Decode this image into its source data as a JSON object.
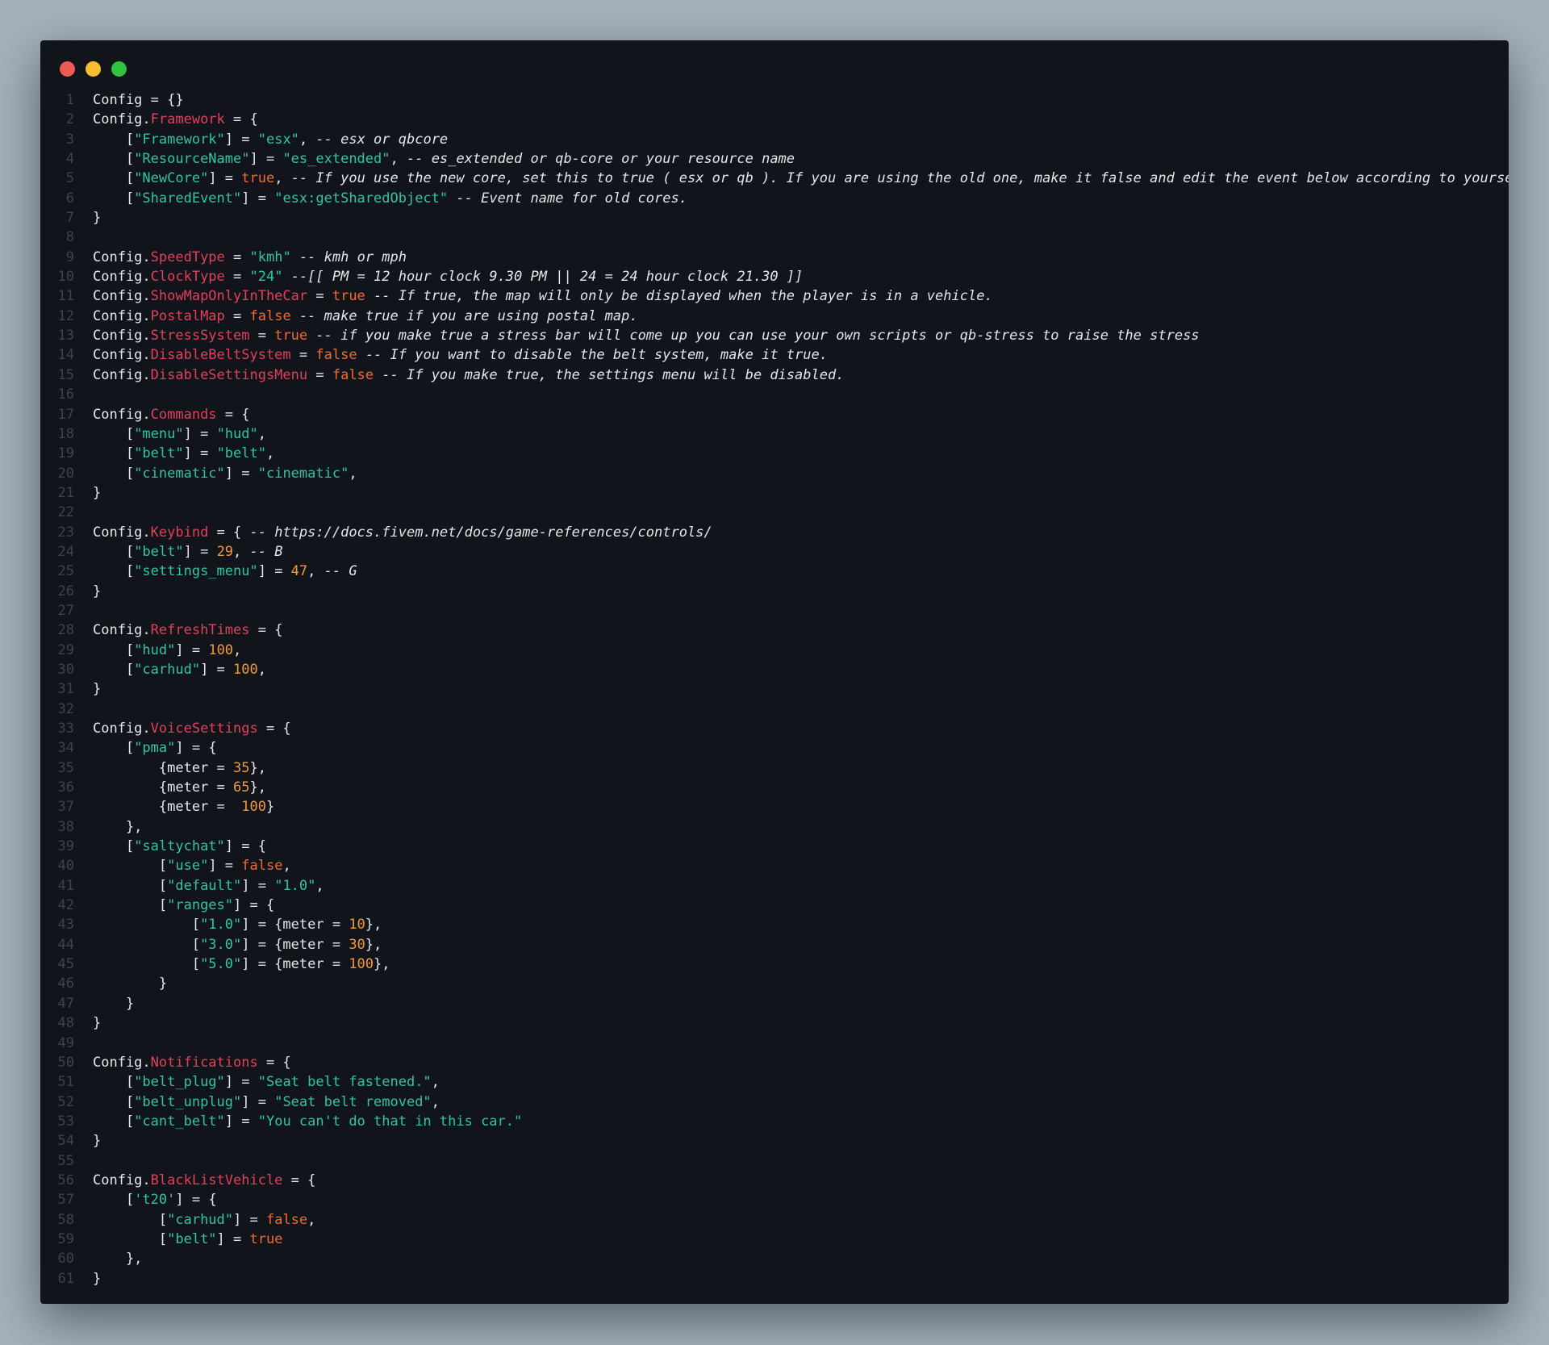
{
  "window": {
    "traffic_lights": [
      {
        "name": "close",
        "color": "#ed5a55"
      },
      {
        "name": "minimize",
        "color": "#f4be2f"
      },
      {
        "name": "zoom",
        "color": "#31c23f"
      }
    ]
  },
  "colors": {
    "background": "#11151b",
    "property": "#e0415a",
    "string": "#2fc5a0",
    "number": "#f29a3a",
    "boolean": "#f06a32",
    "text": "#e3e6ea",
    "line_number": "#3b434d"
  },
  "code": {
    "lines": [
      [
        [
          "p",
          "Config = {}"
        ]
      ],
      [
        [
          "p",
          "Config."
        ],
        [
          "k",
          "Framework"
        ],
        [
          "p",
          " = {"
        ]
      ],
      [
        [
          "p",
          "    ["
        ],
        [
          "s",
          "\"Framework\""
        ],
        [
          "p",
          "] = "
        ],
        [
          "s",
          "\"esx\""
        ],
        [
          "p",
          ", "
        ],
        [
          "c",
          "-- esx or qbcore"
        ]
      ],
      [
        [
          "p",
          "    ["
        ],
        [
          "s",
          "\"ResourceName\""
        ],
        [
          "p",
          "] = "
        ],
        [
          "s",
          "\"es_extended\""
        ],
        [
          "p",
          ", "
        ],
        [
          "c",
          "-- es_extended or qb-core or your resource name"
        ]
      ],
      [
        [
          "p",
          "    ["
        ],
        [
          "s",
          "\"NewCore\""
        ],
        [
          "p",
          "] = "
        ],
        [
          "b",
          "true"
        ],
        [
          "p",
          ", "
        ],
        [
          "c",
          "-- If you use the new core, set this to true ( esx or qb ). If you are using the old one, make it false and edit the event below according to yourself."
        ]
      ],
      [
        [
          "p",
          "    ["
        ],
        [
          "s",
          "\"SharedEvent\""
        ],
        [
          "p",
          "] = "
        ],
        [
          "s",
          "\"esx:getSharedObject\""
        ],
        [
          "p",
          " "
        ],
        [
          "c",
          "-- Event name for old cores."
        ]
      ],
      [
        [
          "p",
          "}"
        ]
      ],
      [],
      [
        [
          "p",
          "Config."
        ],
        [
          "k",
          "SpeedType"
        ],
        [
          "p",
          " = "
        ],
        [
          "s",
          "\"kmh\""
        ],
        [
          "p",
          " "
        ],
        [
          "c",
          "-- kmh or mph"
        ]
      ],
      [
        [
          "p",
          "Config."
        ],
        [
          "k",
          "ClockType"
        ],
        [
          "p",
          " = "
        ],
        [
          "s",
          "\"24\""
        ],
        [
          "p",
          " "
        ],
        [
          "c",
          "--[[ PM = 12 hour clock 9.30 PM || 24 = 24 hour clock 21.30 ]]"
        ]
      ],
      [
        [
          "p",
          "Config."
        ],
        [
          "k",
          "ShowMapOnlyInTheCar"
        ],
        [
          "p",
          " = "
        ],
        [
          "b",
          "true"
        ],
        [
          "p",
          " "
        ],
        [
          "c",
          "-- If true, the map will only be displayed when the player is in a vehicle."
        ]
      ],
      [
        [
          "p",
          "Config."
        ],
        [
          "k",
          "PostalMap"
        ],
        [
          "p",
          " = "
        ],
        [
          "b",
          "false"
        ],
        [
          "p",
          " "
        ],
        [
          "c",
          "-- make true if you are using postal map."
        ]
      ],
      [
        [
          "p",
          "Config."
        ],
        [
          "k",
          "StressSystem"
        ],
        [
          "p",
          " = "
        ],
        [
          "b",
          "true"
        ],
        [
          "p",
          " "
        ],
        [
          "c",
          "-- if you make true a stress bar will come up you can use your own scripts or qb-stress to raise the stress"
        ]
      ],
      [
        [
          "p",
          "Config."
        ],
        [
          "k",
          "DisableBeltSystem"
        ],
        [
          "p",
          " = "
        ],
        [
          "b",
          "false"
        ],
        [
          "p",
          " "
        ],
        [
          "c",
          "-- If you want to disable the belt system, make it true."
        ]
      ],
      [
        [
          "p",
          "Config."
        ],
        [
          "k",
          "DisableSettingsMenu"
        ],
        [
          "p",
          " = "
        ],
        [
          "b",
          "false"
        ],
        [
          "p",
          " "
        ],
        [
          "c",
          "-- If you make true, the settings menu will be disabled."
        ]
      ],
      [],
      [
        [
          "p",
          "Config."
        ],
        [
          "k",
          "Commands"
        ],
        [
          "p",
          " = {"
        ]
      ],
      [
        [
          "p",
          "    ["
        ],
        [
          "s",
          "\"menu\""
        ],
        [
          "p",
          "] = "
        ],
        [
          "s",
          "\"hud\""
        ],
        [
          "p",
          ","
        ]
      ],
      [
        [
          "p",
          "    ["
        ],
        [
          "s",
          "\"belt\""
        ],
        [
          "p",
          "] = "
        ],
        [
          "s",
          "\"belt\""
        ],
        [
          "p",
          ","
        ]
      ],
      [
        [
          "p",
          "    ["
        ],
        [
          "s",
          "\"cinematic\""
        ],
        [
          "p",
          "] = "
        ],
        [
          "s",
          "\"cinematic\""
        ],
        [
          "p",
          ","
        ]
      ],
      [
        [
          "p",
          "}"
        ]
      ],
      [],
      [
        [
          "p",
          "Config."
        ],
        [
          "k",
          "Keybind"
        ],
        [
          "p",
          " = { "
        ],
        [
          "c",
          "-- https://docs.fivem.net/docs/game-references/controls/"
        ]
      ],
      [
        [
          "p",
          "    ["
        ],
        [
          "s",
          "\"belt\""
        ],
        [
          "p",
          "] = "
        ],
        [
          "n",
          "29"
        ],
        [
          "p",
          ", "
        ],
        [
          "c",
          "-- B"
        ]
      ],
      [
        [
          "p",
          "    ["
        ],
        [
          "s",
          "\"settings_menu\""
        ],
        [
          "p",
          "] = "
        ],
        [
          "n",
          "47"
        ],
        [
          "p",
          ", "
        ],
        [
          "c",
          "-- G"
        ]
      ],
      [
        [
          "p",
          "}"
        ]
      ],
      [],
      [
        [
          "p",
          "Config."
        ],
        [
          "k",
          "RefreshTimes"
        ],
        [
          "p",
          " = {"
        ]
      ],
      [
        [
          "p",
          "    ["
        ],
        [
          "s",
          "\"hud\""
        ],
        [
          "p",
          "] = "
        ],
        [
          "n",
          "100"
        ],
        [
          "p",
          ","
        ]
      ],
      [
        [
          "p",
          "    ["
        ],
        [
          "s",
          "\"carhud\""
        ],
        [
          "p",
          "] = "
        ],
        [
          "n",
          "100"
        ],
        [
          "p",
          ","
        ]
      ],
      [
        [
          "p",
          "}"
        ]
      ],
      [],
      [
        [
          "p",
          "Config."
        ],
        [
          "k",
          "VoiceSettings"
        ],
        [
          "p",
          " = {"
        ]
      ],
      [
        [
          "p",
          "    ["
        ],
        [
          "s",
          "\"pma\""
        ],
        [
          "p",
          "] = {"
        ]
      ],
      [
        [
          "p",
          "        {meter = "
        ],
        [
          "n",
          "35"
        ],
        [
          "p",
          "},"
        ]
      ],
      [
        [
          "p",
          "        {meter = "
        ],
        [
          "n",
          "65"
        ],
        [
          "p",
          "},"
        ]
      ],
      [
        [
          "p",
          "        {meter =  "
        ],
        [
          "n",
          "100"
        ],
        [
          "p",
          "}"
        ]
      ],
      [
        [
          "p",
          "    },"
        ]
      ],
      [
        [
          "p",
          "    ["
        ],
        [
          "s",
          "\"saltychat\""
        ],
        [
          "p",
          "] = {"
        ]
      ],
      [
        [
          "p",
          "        ["
        ],
        [
          "s",
          "\"use\""
        ],
        [
          "p",
          "] = "
        ],
        [
          "b",
          "false"
        ],
        [
          "p",
          ","
        ]
      ],
      [
        [
          "p",
          "        ["
        ],
        [
          "s",
          "\"default\""
        ],
        [
          "p",
          "] = "
        ],
        [
          "s",
          "\"1.0\""
        ],
        [
          "p",
          ","
        ]
      ],
      [
        [
          "p",
          "        ["
        ],
        [
          "s",
          "\"ranges\""
        ],
        [
          "p",
          "] = {"
        ]
      ],
      [
        [
          "p",
          "            ["
        ],
        [
          "s",
          "\"1.0\""
        ],
        [
          "p",
          "] = {meter = "
        ],
        [
          "n",
          "10"
        ],
        [
          "p",
          "},"
        ]
      ],
      [
        [
          "p",
          "            ["
        ],
        [
          "s",
          "\"3.0\""
        ],
        [
          "p",
          "] = {meter = "
        ],
        [
          "n",
          "30"
        ],
        [
          "p",
          "},"
        ]
      ],
      [
        [
          "p",
          "            ["
        ],
        [
          "s",
          "\"5.0\""
        ],
        [
          "p",
          "] = {meter = "
        ],
        [
          "n",
          "100"
        ],
        [
          "p",
          "},"
        ]
      ],
      [
        [
          "p",
          "        }"
        ]
      ],
      [
        [
          "p",
          "    }"
        ]
      ],
      [
        [
          "p",
          "}"
        ]
      ],
      [],
      [
        [
          "p",
          "Config."
        ],
        [
          "k",
          "Notifications"
        ],
        [
          "p",
          " = {"
        ]
      ],
      [
        [
          "p",
          "    ["
        ],
        [
          "s",
          "\"belt_plug\""
        ],
        [
          "p",
          "] = "
        ],
        [
          "s",
          "\"Seat belt fastened.\""
        ],
        [
          "p",
          ","
        ]
      ],
      [
        [
          "p",
          "    ["
        ],
        [
          "s",
          "\"belt_unplug\""
        ],
        [
          "p",
          "] = "
        ],
        [
          "s",
          "\"Seat belt removed\""
        ],
        [
          "p",
          ","
        ]
      ],
      [
        [
          "p",
          "    ["
        ],
        [
          "s",
          "\"cant_belt\""
        ],
        [
          "p",
          "] = "
        ],
        [
          "s",
          "\"You can't do that in this car.\""
        ]
      ],
      [
        [
          "p",
          "}"
        ]
      ],
      [],
      [
        [
          "p",
          "Config."
        ],
        [
          "k",
          "BlackListVehicle"
        ],
        [
          "p",
          " = {"
        ]
      ],
      [
        [
          "p",
          "    ["
        ],
        [
          "s",
          "'t20'"
        ],
        [
          "p",
          "] = {"
        ]
      ],
      [
        [
          "p",
          "        ["
        ],
        [
          "s",
          "\"carhud\""
        ],
        [
          "p",
          "] = "
        ],
        [
          "b",
          "false"
        ],
        [
          "p",
          ","
        ]
      ],
      [
        [
          "p",
          "        ["
        ],
        [
          "s",
          "\"belt\""
        ],
        [
          "p",
          "] = "
        ],
        [
          "b",
          "true"
        ]
      ],
      [
        [
          "p",
          "    },"
        ]
      ],
      [
        [
          "p",
          "}"
        ]
      ]
    ]
  }
}
